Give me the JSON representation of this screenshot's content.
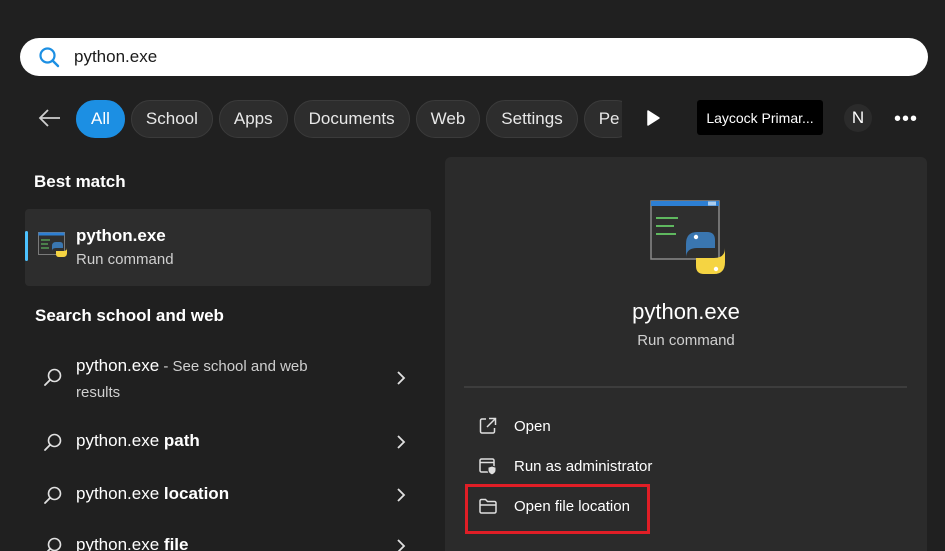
{
  "search": {
    "value": "python.exe",
    "icon": "search-icon"
  },
  "filters": {
    "chips": [
      "All",
      "School",
      "Apps",
      "Documents",
      "Web",
      "Settings",
      "Pe"
    ],
    "active": "All",
    "org_label": "Laycock Primar...",
    "avatar_initial": "N",
    "more_label": "•••"
  },
  "best_match": {
    "heading": "Best match",
    "title": "python.exe",
    "subtitle": "Run command"
  },
  "web_section": {
    "heading": "Search school and web",
    "items": [
      {
        "prefix": "python.exe",
        "bold": "",
        "hint": " - See school and web",
        "hint2": "results"
      },
      {
        "prefix": "python.exe ",
        "bold": "path"
      },
      {
        "prefix": "python.exe ",
        "bold": "location"
      },
      {
        "prefix": "python.exe ",
        "bold": "file"
      }
    ]
  },
  "preview": {
    "title": "python.exe",
    "subtitle": "Run command",
    "actions": [
      {
        "label": "Open",
        "icon": "open-external-icon"
      },
      {
        "label": "Run as administrator",
        "icon": "shield-admin-icon"
      },
      {
        "label": "Open file location",
        "icon": "folder-icon"
      }
    ]
  },
  "colors": {
    "accent": "#1c8fe3",
    "highlight": "#e01e26",
    "background": "#202020"
  }
}
